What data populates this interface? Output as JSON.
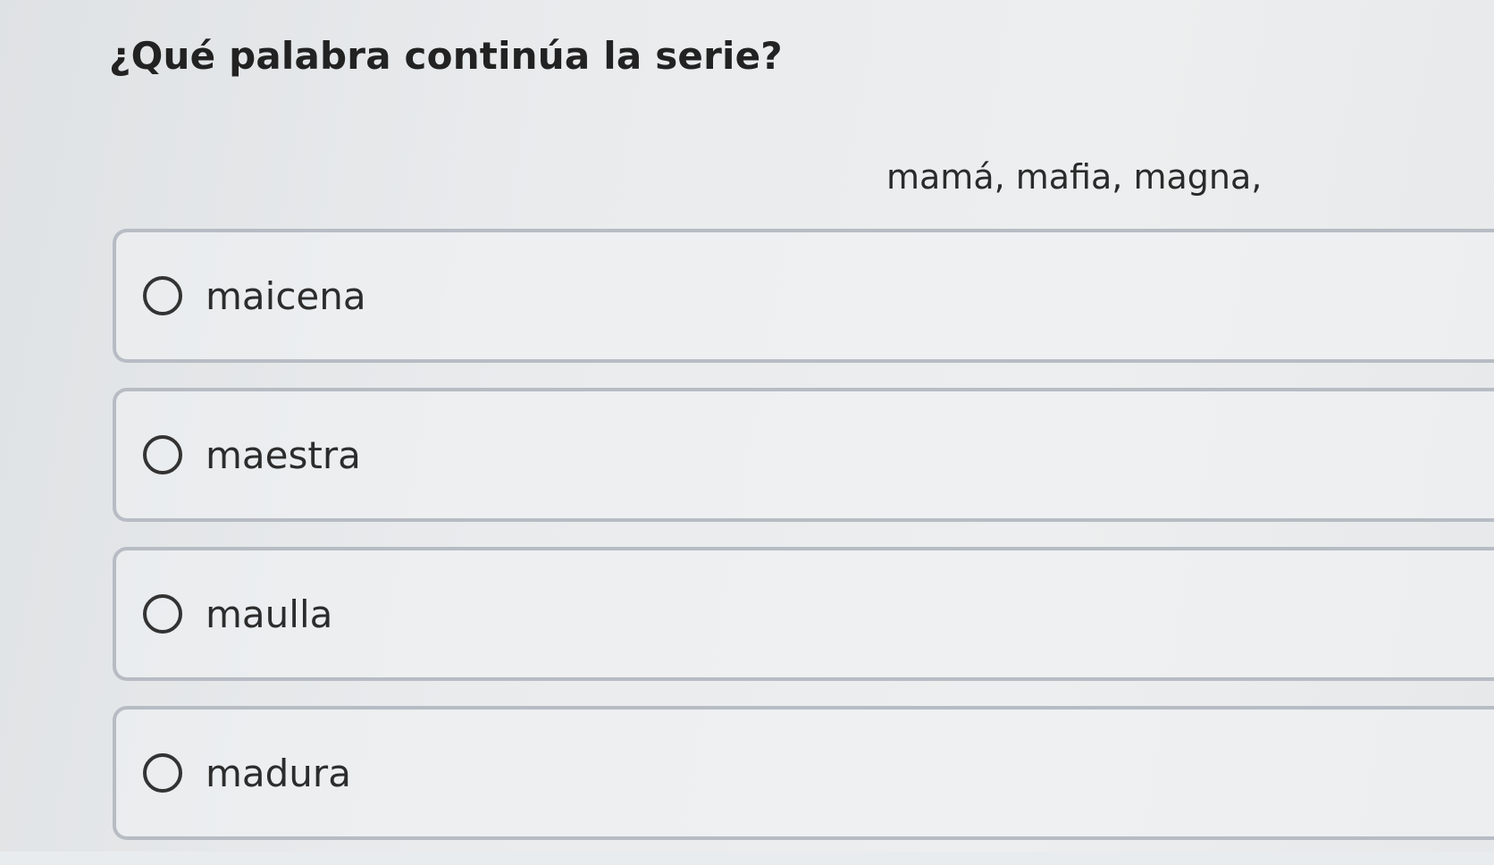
{
  "question": {
    "title": "¿Qué palabra continúa la serie?",
    "series": "mamá, mafia, magna,"
  },
  "options": [
    {
      "label": "maicena",
      "selected": false
    },
    {
      "label": "maestra",
      "selected": false
    },
    {
      "label": "maulla",
      "selected": false
    },
    {
      "label": "madura",
      "selected": false
    }
  ]
}
